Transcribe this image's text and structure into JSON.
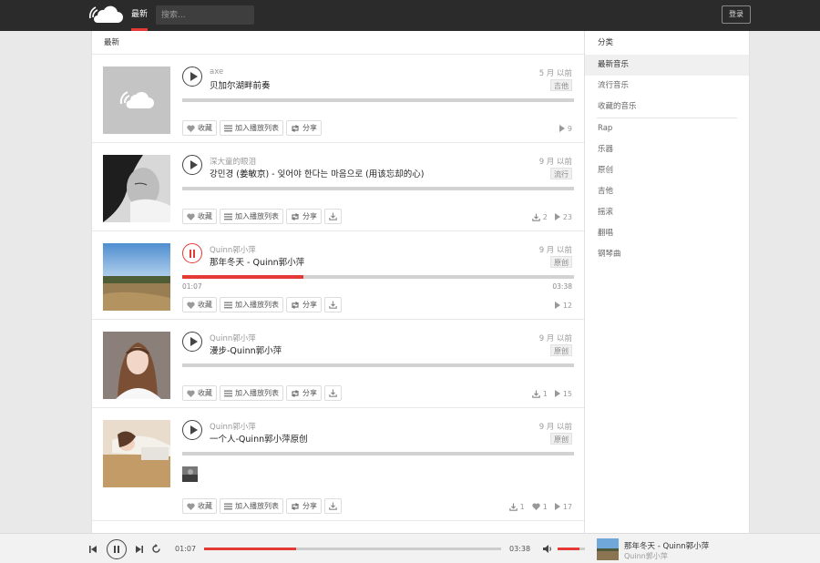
{
  "nav": {
    "logo_icon": "cloud-logo-icon",
    "active_tab": "最新",
    "search_placeholder": "搜索...",
    "login_label": "登录"
  },
  "main": {
    "header": "最新",
    "tracks": [
      {
        "artist": "axe",
        "title": "贝加尔湖畔前奏",
        "time": "5 月 以前",
        "tag": "吉他",
        "cover": "placeholder-cloud",
        "state": "paused",
        "plays": "9",
        "downloads": "",
        "likes": ""
      },
      {
        "artist": "深大童的眼泪",
        "title": "강민경 (姜敏京) - 잊어야 한다는 마음으로 (用该忘却的心)",
        "time": "9 月 以前",
        "tag": "流行",
        "cover": "girl-bw",
        "state": "paused",
        "plays": "23",
        "downloads": "2",
        "likes": ""
      },
      {
        "artist": "Quinn郭小萍",
        "title": "那年冬天 - Quinn郭小萍",
        "time": "9 月 以前",
        "tag": "原创",
        "cover": "landscape",
        "state": "playing",
        "progress": 0.31,
        "elapsed": "01:07",
        "duration": "03:38",
        "plays": "12",
        "downloads": "",
        "likes": ""
      },
      {
        "artist": "Quinn郭小萍",
        "title": "漫步-Quinn郭小萍",
        "time": "9 月 以前",
        "tag": "原创",
        "cover": "girl-portrait",
        "state": "paused",
        "plays": "15",
        "downloads": "1",
        "likes": ""
      },
      {
        "artist": "Quinn郭小萍",
        "title": "一个人-Quinn郭小萍原创",
        "time": "9 月 以前",
        "tag": "原创",
        "cover": "girl-lying",
        "state": "paused",
        "plays": "17",
        "downloads": "1",
        "likes": "1"
      }
    ],
    "actions": {
      "like": "收藏",
      "playlist": "加入播放列表",
      "share": "分享"
    }
  },
  "sidebar": {
    "title": "分类",
    "items": [
      "最新音乐",
      "流行音乐",
      "收藏的音乐"
    ],
    "categories": [
      "Rap",
      "乐器",
      "原创",
      "吉他",
      "摇滚",
      "翻唱",
      "钢琴曲"
    ]
  },
  "player": {
    "elapsed": "01:07",
    "duration": "03:38",
    "progress": 0.31,
    "volume": 0.8,
    "title": "那年冬天 - Quinn郭小萍",
    "artist": "Quinn郭小萍"
  },
  "colors": {
    "accent": "#e53935",
    "topbar": "#2b2b2b"
  }
}
